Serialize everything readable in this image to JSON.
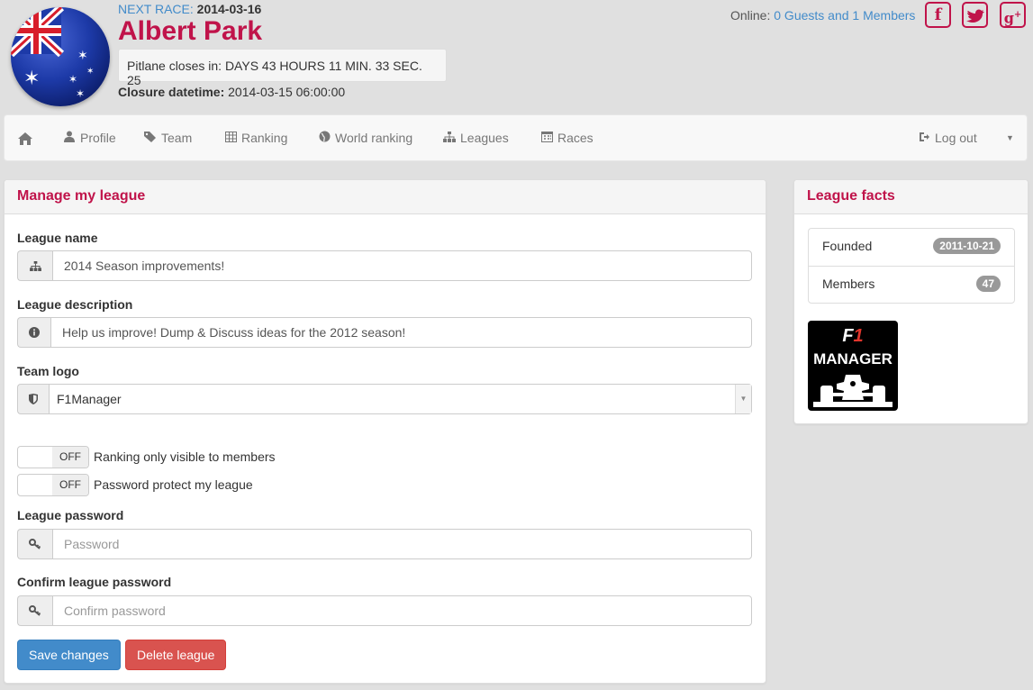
{
  "header": {
    "next_race_label": "NEXT RACE:",
    "next_race_date": "2014-03-16",
    "race_name": "Albert Park",
    "pitlane_text": "Pitlane closes in: DAYS 43 HOURS 11 MIN. 33 SEC. 25",
    "closure_label": "Closure datetime:",
    "closure_value": "2014-03-15 06:00:00",
    "online_label": "Online:",
    "online_value": "0 Guests and 1 Members",
    "social": [
      {
        "name": "facebook-icon",
        "glyph": "f"
      },
      {
        "name": "twitter-icon",
        "glyph": "t"
      },
      {
        "name": "google-plus-icon",
        "glyph": "g+"
      }
    ]
  },
  "nav": {
    "items": [
      {
        "label": "Profile"
      },
      {
        "label": "Team"
      },
      {
        "label": "Ranking"
      },
      {
        "label": "World ranking"
      },
      {
        "label": "Leagues"
      },
      {
        "label": "Races"
      }
    ],
    "logout_label": "Log out"
  },
  "manage": {
    "title": "Manage my league",
    "name_label": "League name",
    "name_value": "2014 Season improvements!",
    "description_label": "League description",
    "description_value": "Help us improve! Dump & Discuss ideas for the 2012 season!",
    "logo_label": "Team logo",
    "logo_value": "F1Manager",
    "toggle_off_text": "OFF",
    "ranking_toggle_label": "Ranking only visible to members",
    "password_toggle_label": "Password protect my league",
    "password_label": "League password",
    "password_placeholder": "Password",
    "confirm_label": "Confirm league password",
    "confirm_placeholder": "Confirm password",
    "save_label": "Save changes",
    "delete_label": "Delete league"
  },
  "facts": {
    "title": "League facts",
    "founded_label": "Founded",
    "founded_value": "2011-10-21",
    "members_label": "Members",
    "members_value": "47",
    "logo_line1_a": "F",
    "logo_line1_b": "1",
    "logo_line2": "MANAGER"
  },
  "colors": {
    "accent": "#c0134a",
    "link": "#428bca",
    "primary": "#428bca",
    "danger": "#d9534f"
  }
}
